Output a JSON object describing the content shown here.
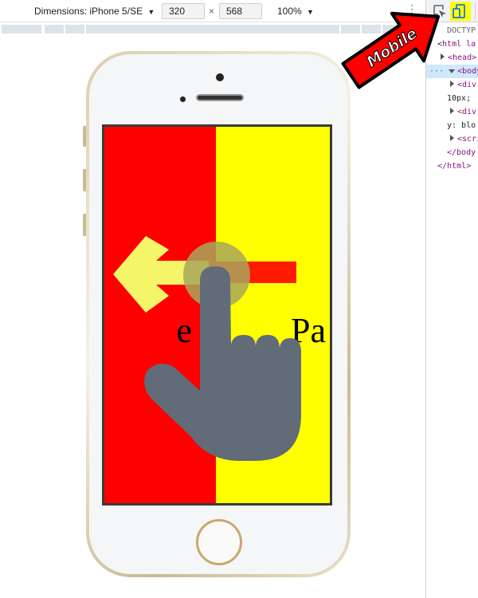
{
  "toolbar": {
    "dimensions_label": "Dimensions: iPhone 5/SE",
    "width_value": "320",
    "times": "×",
    "height_value": "568",
    "zoom_label": "100%",
    "more_glyph": "⋮"
  },
  "devtools": {
    "lines": [
      "DOCTYP",
      "html la",
      "<head>",
      "<body>",
      "<div",
      "10px;",
      "<div",
      "y: blo",
      "<scri",
      "</body",
      "</html>"
    ]
  },
  "screen": {
    "left_text": "e 1",
    "right_text": "Pa",
    "left_color": "#ff0000",
    "right_color": "#ffff00"
  },
  "annotation": {
    "label": "Mobile",
    "arrow_color": "#ff0000",
    "highlight_color": "#ffff00"
  },
  "icons": [
    "dropdown-caret-icon",
    "inspect-element-icon",
    "device-toggle-icon",
    "swipe-left-arrow-icon",
    "hand-pointer-icon"
  ]
}
